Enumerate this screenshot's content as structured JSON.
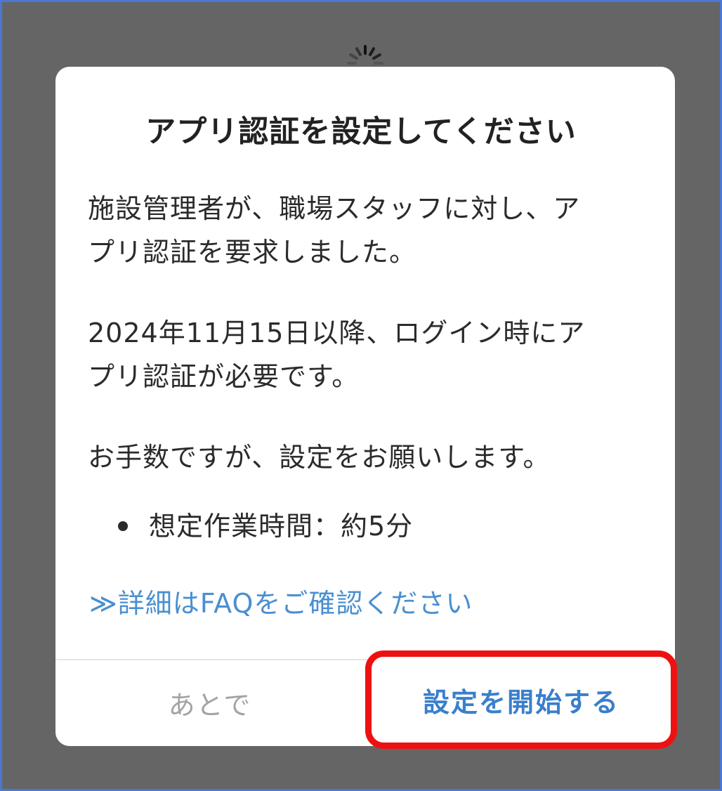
{
  "dialog": {
    "title": "アプリ認証を設定してください",
    "paragraph1_line1": "施設管理者が、職場スタッフに対し、ア",
    "paragraph1_line2": "プリ認証を要求しました。",
    "paragraph2_line1": "2024年11月15日以降、ログイン時にア",
    "paragraph2_line2": "プリ認証が必要です。",
    "paragraph3": "お手数ですが、設定をお願いします。",
    "bullet": "想定作業時間：約5分",
    "faq_link": "≫詳細はFAQをご確認ください",
    "later_button": "あとで",
    "start_button": "設定を開始する"
  },
  "colors": {
    "overlay": "#656565",
    "frame_border": "#4a78d4",
    "link": "#4a8fd0",
    "primary_button_text": "#3a7fcc",
    "highlight_border": "#ee1111",
    "secondary_button_text": "#a3a3a3"
  },
  "icons": {
    "loading": "spinner-icon",
    "bullet": "bullet-dot-icon"
  }
}
